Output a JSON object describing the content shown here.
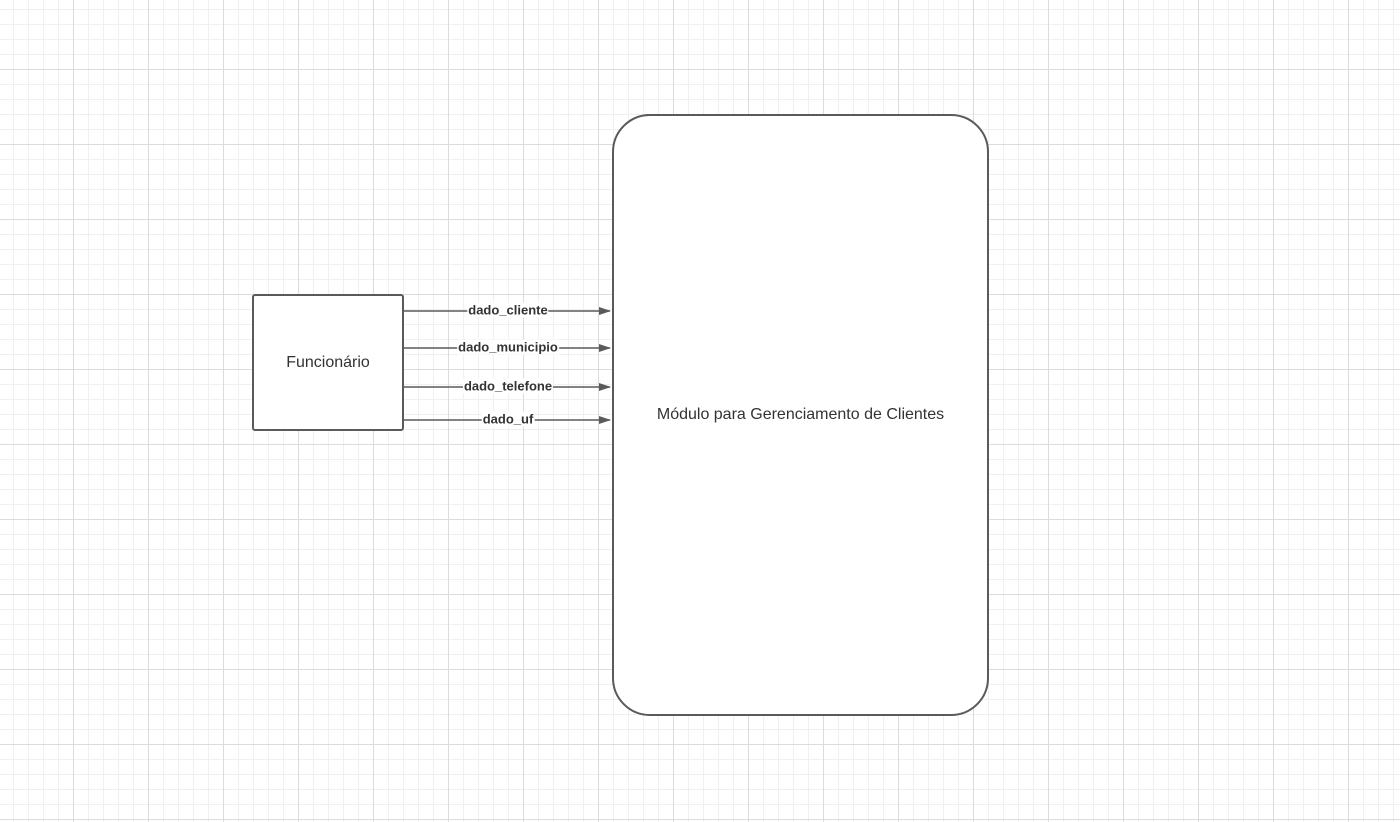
{
  "diagram": {
    "nodes": {
      "actor": {
        "label": "Funcionário"
      },
      "module": {
        "label": "Módulo para Gerenciamento de Clientes"
      }
    },
    "flows": [
      {
        "id": "cliente",
        "from": "Funcionário",
        "to": "Módulo para Gerenciamento de Clientes",
        "label": "dado_cliente"
      },
      {
        "id": "municipio",
        "from": "Funcionário",
        "to": "Módulo para Gerenciamento de Clientes",
        "label": "dado_municipio"
      },
      {
        "id": "telefone",
        "from": "Funcionário",
        "to": "Módulo para Gerenciamento de Clientes",
        "label": "dado_telefone"
      },
      {
        "id": "uf",
        "from": "Funcionário",
        "to": "Módulo para Gerenciamento de Clientes",
        "label": "dado_uf"
      }
    ]
  },
  "colors": {
    "stroke": "#5a5a5a",
    "text": "#333333",
    "grid_major": "#dcdcdc",
    "grid_minor": "#f0f0f0",
    "background": "#ffffff"
  }
}
